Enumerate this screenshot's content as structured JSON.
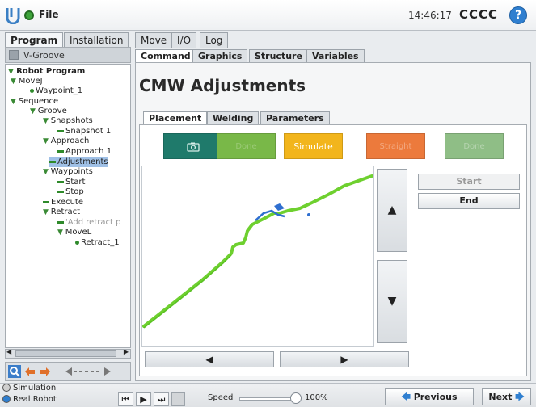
{
  "app": {
    "file_label": "File",
    "clock": "14:46:17",
    "robot_name": "CCCC",
    "help": "?"
  },
  "main_tabs": [
    {
      "label": "Program",
      "active": true
    },
    {
      "label": "Installation",
      "active": false
    },
    {
      "label": "Move",
      "active": false
    },
    {
      "label": "I/O",
      "active": false
    },
    {
      "label": "Log",
      "active": false
    }
  ],
  "program_name": "V-Groove",
  "tree": [
    {
      "label": "Robot Program"
    },
    {
      "label": "MoveJ"
    },
    {
      "label": "Waypoint_1"
    },
    {
      "label": "Sequence"
    },
    {
      "label": "Groove"
    },
    {
      "label": "Snapshots"
    },
    {
      "label": "Snapshot 1"
    },
    {
      "label": "Approach"
    },
    {
      "label": "Approach 1"
    },
    {
      "label": "Adjustments"
    },
    {
      "label": "Waypoints"
    },
    {
      "label": "Start"
    },
    {
      "label": "Stop"
    },
    {
      "label": "Execute"
    },
    {
      "label": "Retract"
    },
    {
      "label": "'Add retract p"
    },
    {
      "label": "MoveL"
    },
    {
      "label": "Retract_1"
    }
  ],
  "sub_tabs": [
    {
      "label": "Command",
      "active": true
    },
    {
      "label": "Graphics",
      "active": false
    },
    {
      "label": "Structure",
      "active": false
    },
    {
      "label": "Variables",
      "active": false
    }
  ],
  "page_title": "CMW Adjustments",
  "panel_tabs": [
    {
      "label": "Placement",
      "active": true
    },
    {
      "label": "Welding",
      "active": false
    },
    {
      "label": "Parameters",
      "active": false
    }
  ],
  "control_buttons": {
    "done": "Done",
    "simulate": "Simulate",
    "straight": "Straight",
    "done2": "Done"
  },
  "side_buttons": {
    "start": "Start",
    "end": "End"
  },
  "footer": {
    "simulation": "Simulation",
    "real_robot": "Real Robot",
    "speed_label": "Speed",
    "speed_value": "100%",
    "speed_fraction": 1.0,
    "previous": "Previous",
    "next": "Next"
  },
  "colors": {
    "camera_btn": "#1f7a6b",
    "done_btn": "#79b848",
    "simulate_btn": "#f2b51c",
    "straight_btn": "#ec7a3c",
    "done2_btn": "#8fbe86",
    "weld_line": "#6ed02f",
    "marker": "#2f6fd0"
  },
  "icons": {
    "camera": "camera-icon",
    "up": "arrow-up-icon",
    "down": "arrow-down-icon",
    "left": "arrow-left-icon",
    "right": "arrow-right-icon"
  }
}
